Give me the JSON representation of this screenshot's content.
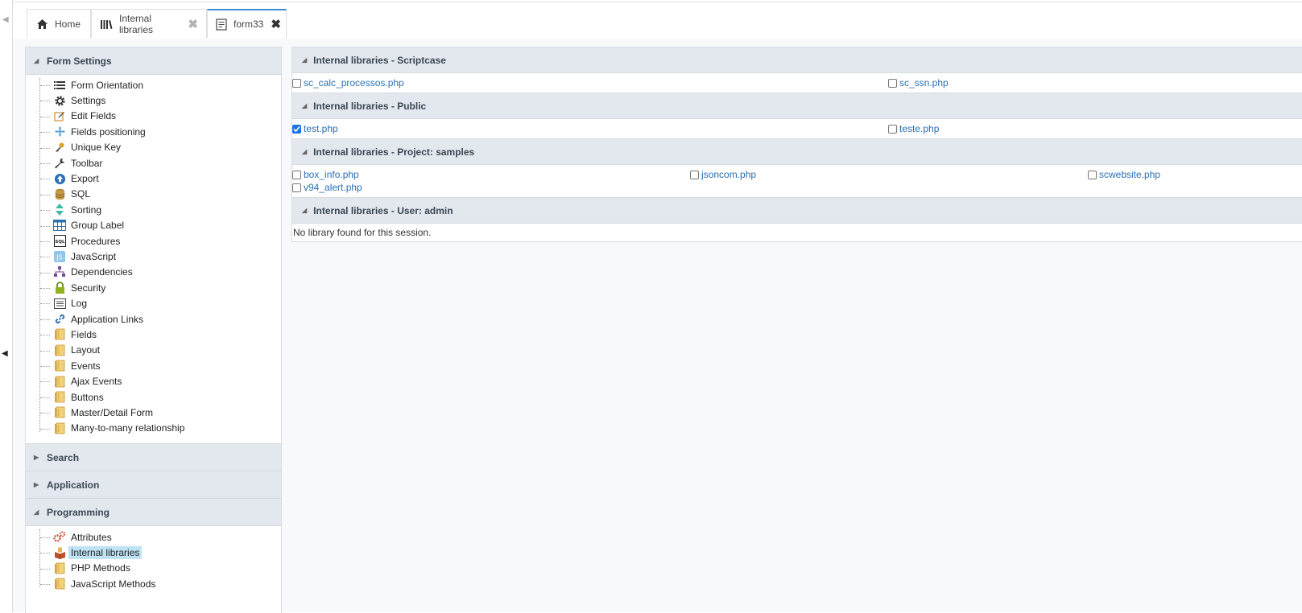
{
  "tabs": [
    {
      "label": "Home",
      "icon": "home-icon",
      "closable": false,
      "active": false
    },
    {
      "label": "Internal libraries",
      "icon": "library-icon",
      "closable": true,
      "active": false
    },
    {
      "label": "form33",
      "icon": "form-icon",
      "closable": true,
      "active": true
    }
  ],
  "sidebar": {
    "form_settings": {
      "title": "Form Settings",
      "items": [
        {
          "label": "Form Orientation",
          "icon": "list-icon"
        },
        {
          "label": "Settings",
          "icon": "gear-icon"
        },
        {
          "label": "Edit Fields",
          "icon": "edit-icon"
        },
        {
          "label": "Fields positioning",
          "icon": "move-icon"
        },
        {
          "label": "Unique Key",
          "icon": "key-icon"
        },
        {
          "label": "Toolbar",
          "icon": "wrench-icon"
        },
        {
          "label": "Export",
          "icon": "export-icon"
        },
        {
          "label": "SQL",
          "icon": "database-icon"
        },
        {
          "label": "Sorting",
          "icon": "sort-icon"
        },
        {
          "label": "Group Label",
          "icon": "grid-icon"
        },
        {
          "label": "Procedures",
          "icon": "sql-icon"
        },
        {
          "label": "JavaScript",
          "icon": "js-icon"
        },
        {
          "label": "Dependencies",
          "icon": "hierarchy-icon"
        },
        {
          "label": "Security",
          "icon": "lock-icon"
        },
        {
          "label": "Log",
          "icon": "log-icon"
        },
        {
          "label": "Application Links",
          "icon": "link-icon"
        },
        {
          "label": "Fields",
          "icon": "folder-icon"
        },
        {
          "label": "Layout",
          "icon": "folder-icon"
        },
        {
          "label": "Events",
          "icon": "folder-icon"
        },
        {
          "label": "Ajax Events",
          "icon": "folder-icon"
        },
        {
          "label": "Buttons",
          "icon": "folder-icon"
        },
        {
          "label": "Master/Detail Form",
          "icon": "folder-icon"
        },
        {
          "label": "Many-to-many relationship",
          "icon": "folder-icon"
        }
      ]
    },
    "search": {
      "title": "Search"
    },
    "application": {
      "title": "Application"
    },
    "programming": {
      "title": "Programming",
      "items": [
        {
          "label": "Attributes",
          "icon": "attributes-icon"
        },
        {
          "label": "Internal libraries",
          "icon": "library-box-icon",
          "selected": true
        },
        {
          "label": "PHP Methods",
          "icon": "folder-icon"
        },
        {
          "label": "JavaScript Methods",
          "icon": "folder-icon"
        }
      ]
    }
  },
  "sections": [
    {
      "title": "Internal libraries - Scriptcase",
      "libs": [
        {
          "name": "sc_calc_processos.php",
          "checked": false
        },
        {
          "name": "sc_ssn.php",
          "checked": false
        }
      ]
    },
    {
      "title": "Internal libraries - Public",
      "libs": [
        {
          "name": "test.php",
          "checked": true
        },
        {
          "name": "teste.php",
          "checked": false
        }
      ]
    },
    {
      "title": "Internal libraries - Project: samples",
      "libs": [
        {
          "name": "box_info.php",
          "checked": false
        },
        {
          "name": "jsoncom.php",
          "checked": false
        },
        {
          "name": "scwebsite.php",
          "checked": false
        },
        {
          "name": "v94_alert.php",
          "checked": false
        }
      ]
    },
    {
      "title": "Internal libraries - User: admin",
      "empty_message": "No library found for this session."
    }
  ],
  "colors": {
    "accent": "#3d8fd6",
    "link": "#2a6fb3",
    "header_bg": "#e3e8ee",
    "selected_bg": "#bfe3f5",
    "checkbox_checked": "#1a73e8"
  }
}
